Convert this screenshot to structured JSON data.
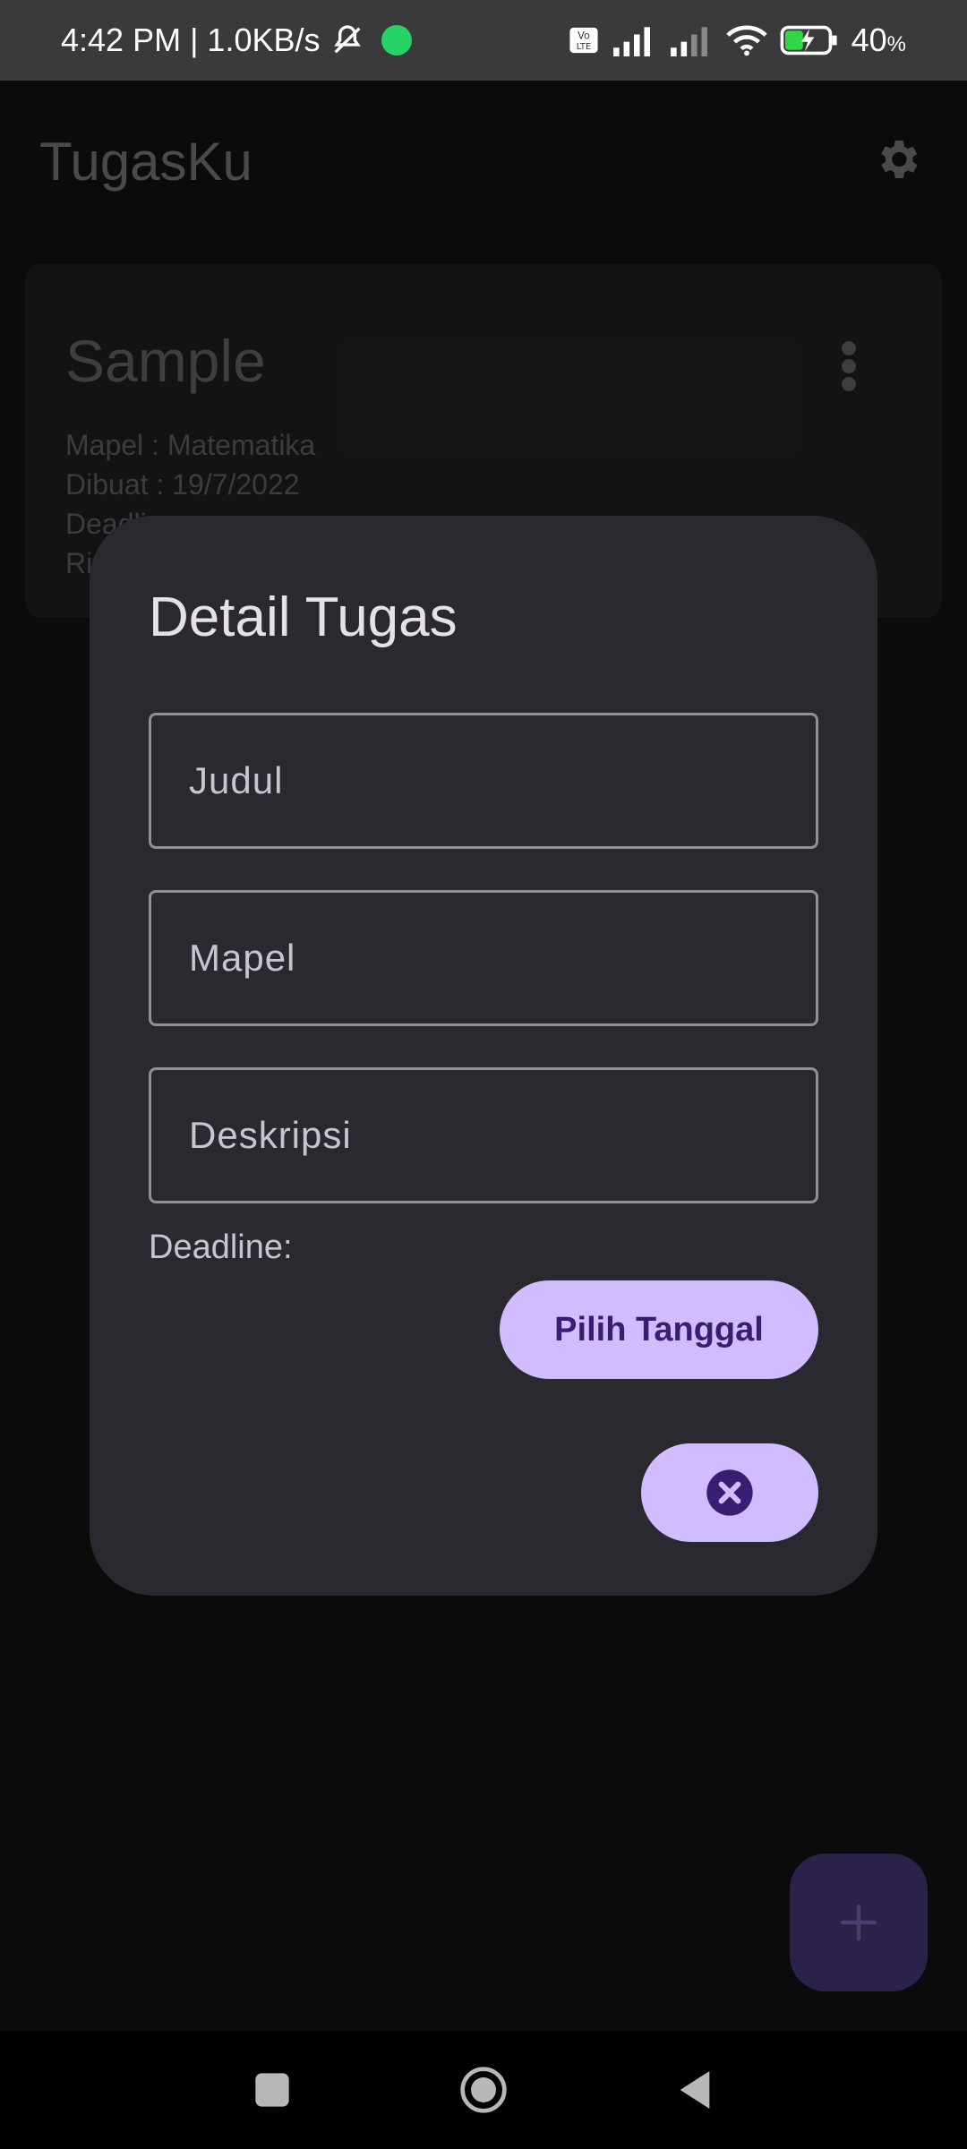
{
  "status_bar": {
    "time_speed": "4:42 PM | 1.0KB/s",
    "battery": "40",
    "battery_unit": "%",
    "icons": [
      "mute-icon",
      "whatsapp-icon",
      "volte-icon",
      "signal-icon",
      "wifi-icon",
      "battery-charging-icon"
    ]
  },
  "app_bar": {
    "title": "TugasKu",
    "settings_icon": "gear-icon"
  },
  "task_card": {
    "title": "Sample",
    "mapel": "Mapel : Matematika",
    "dibuat": "Dibuat : 19/7/2022",
    "deadline_partial": "Deadli...",
    "extra_partial": "Ri"
  },
  "dialog": {
    "title": "Detail Tugas",
    "judul_placeholder": "Judul",
    "mapel_placeholder": "Mapel",
    "deskripsi_placeholder": "Deskripsi",
    "deadline_label": "Deadline:",
    "pick_date_label": "Pilih Tanggal",
    "close_icon": "close-circle-icon"
  },
  "fab": {
    "icon": "plus-icon"
  },
  "nav_bar": {
    "icons": [
      "recents-icon",
      "home-icon",
      "back-icon"
    ]
  },
  "colors": {
    "accent": "#d0bcff",
    "on_accent": "#381e72",
    "dialog_surface": "#2b2930",
    "fab": "#2b2149"
  }
}
